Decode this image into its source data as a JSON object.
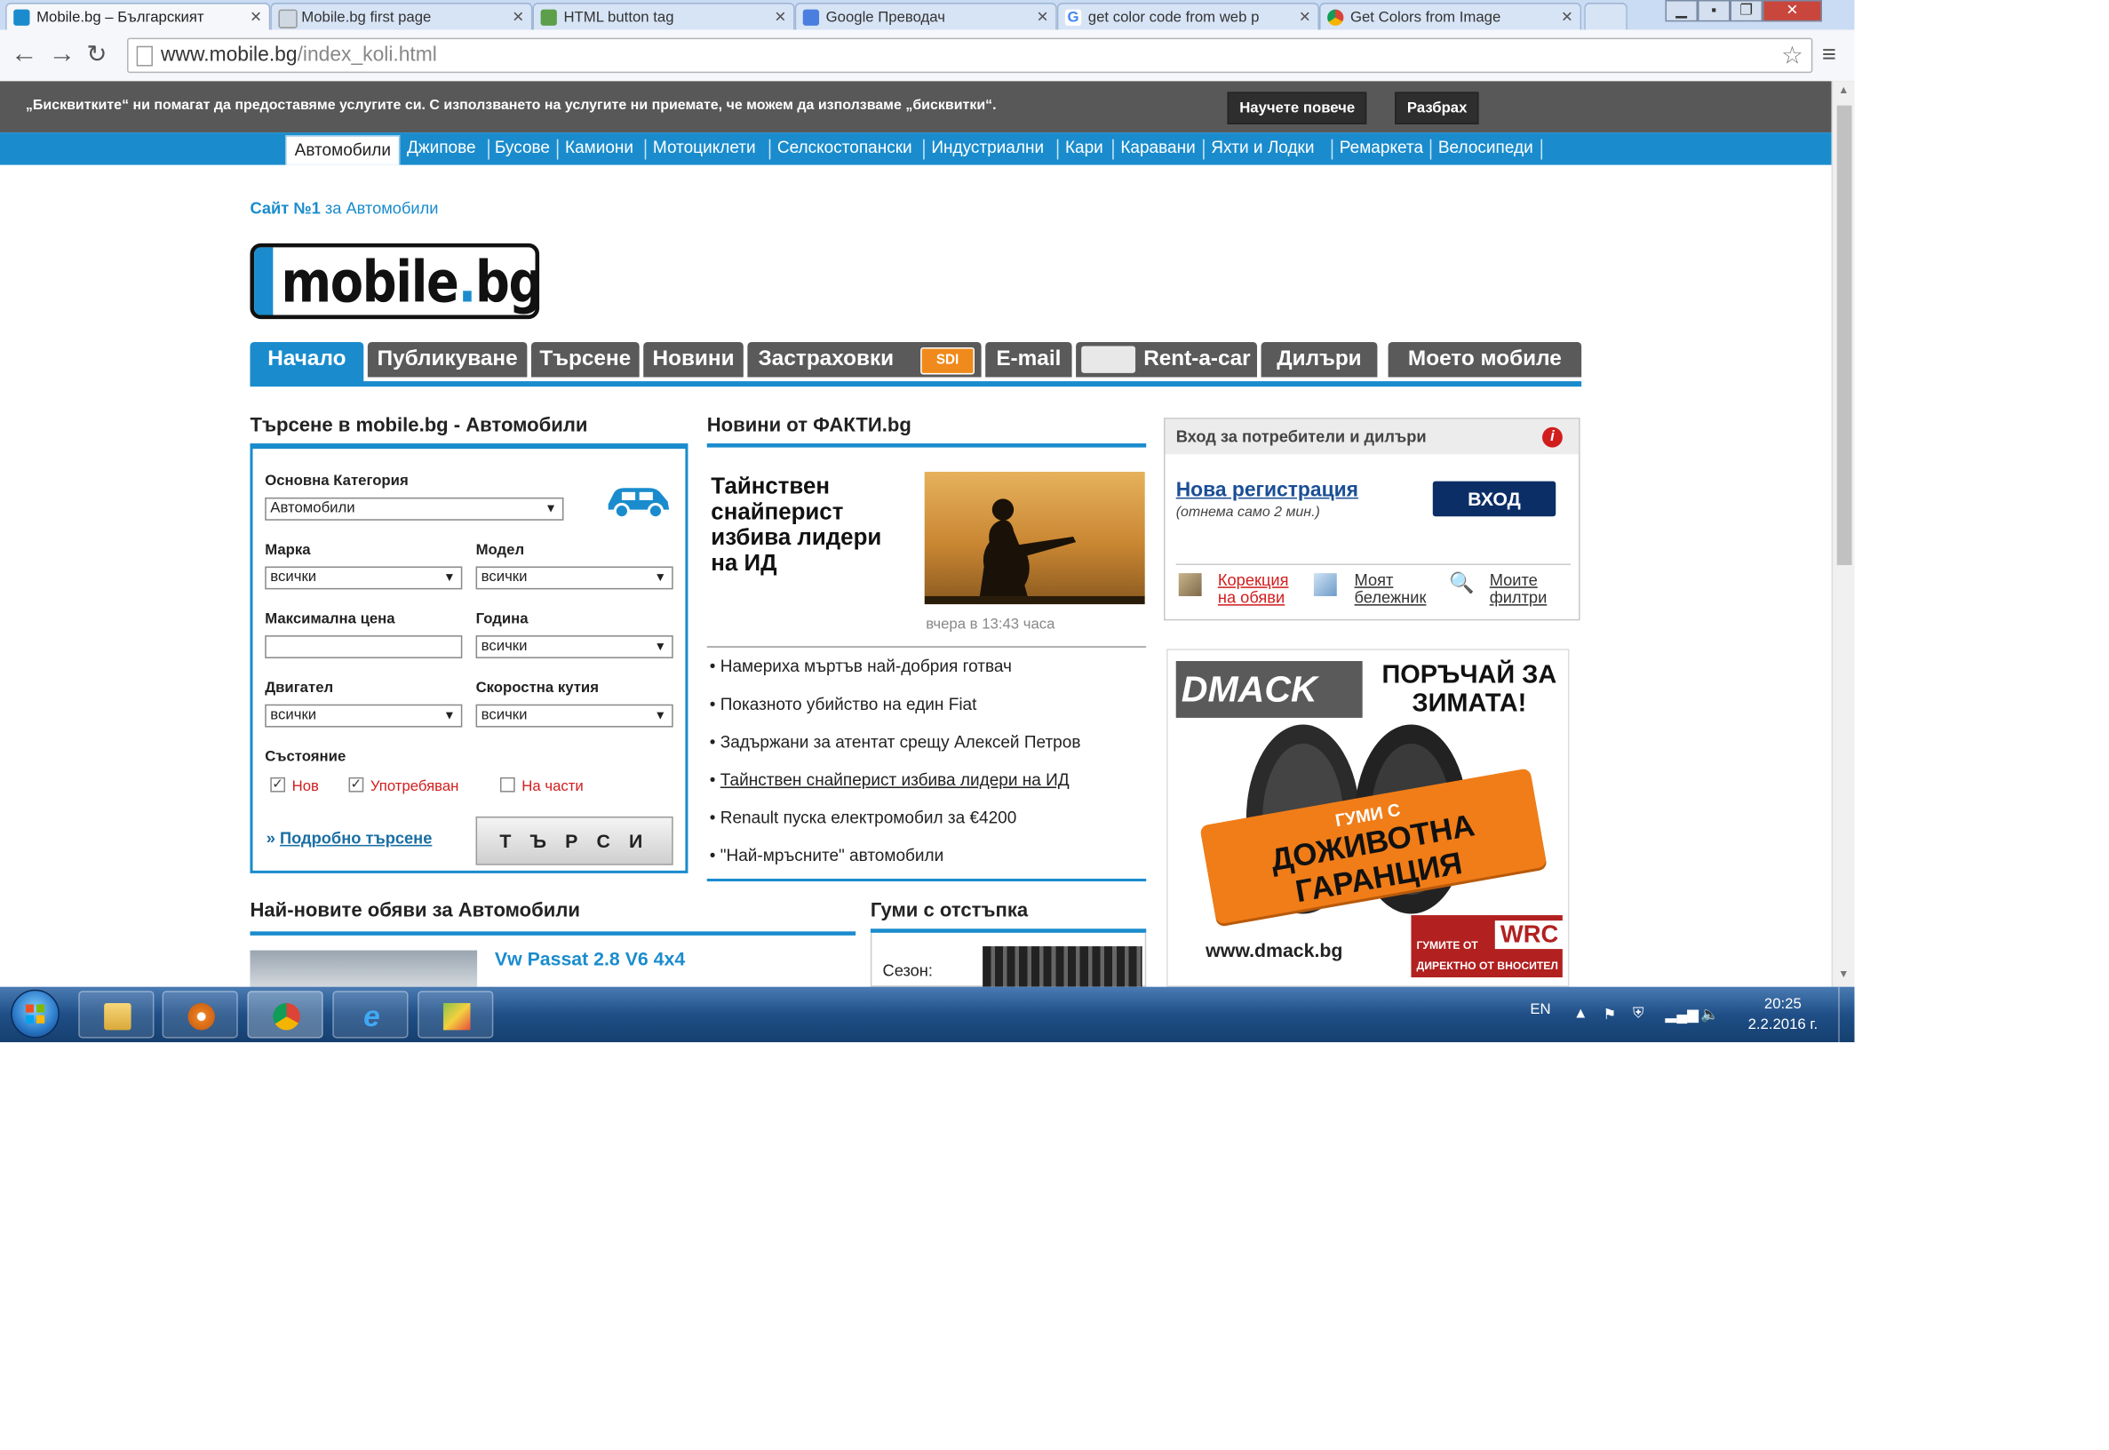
{
  "browser": {
    "tabs": [
      {
        "label": "Mobile.bg – Българският",
        "active": true
      },
      {
        "label": "Mobile.bg first page"
      },
      {
        "label": "HTML button tag"
      },
      {
        "label": "Google Преводач"
      },
      {
        "label": "get color code from web p"
      },
      {
        "label": "Get Colors from Image"
      }
    ],
    "url_host": "www.mobile.bg",
    "url_path": "/index_koli.html"
  },
  "cookie_bar": {
    "text": "„Бисквитките“ ни помагат да предоставяме услугите си. С използването на услугите ни приемате, че можем да използваме „бисквитки“.",
    "learn_more": "Научете повече",
    "accept": "Разбрах"
  },
  "category_bar": {
    "active": "Автомобили",
    "items": [
      "Джипове",
      "Бусове",
      "Камиони",
      "Мотоциклети",
      "Селскостопански",
      "Индустриални",
      "Кари",
      "Каравани",
      "Яхти и Лодки",
      "Ремаркета",
      "Велосипеди"
    ]
  },
  "tagline": {
    "strong": "Сайт №1",
    "rest": " за Автомобили"
  },
  "logo": {
    "text": "mobile",
    "dot": ".",
    "tld": "bg"
  },
  "main_nav": {
    "items": [
      "Начало",
      "Публикуване",
      "Търсене",
      "Новини",
      "Застраховки",
      "E-mail",
      "Rent-a-car",
      "Дилъри"
    ],
    "badge": "SDI",
    "my": "Моето мобиле"
  },
  "search": {
    "title": "Търсене в mobile.bg - Автомобили",
    "main_category_label": "Основна Категория",
    "main_category_value": "Автомобили",
    "brand_label": "Марка",
    "brand_value": "всички",
    "model_label": "Модел",
    "model_value": "всички",
    "max_price_label": "Максимална цена",
    "year_label": "Година",
    "year_value": "всички",
    "engine_label": "Двигател",
    "engine_value": "всички",
    "gearbox_label": "Скоростна кутия",
    "gearbox_value": "всички",
    "condition_label": "Състояние",
    "cond_new": "Нов",
    "cond_used": "Употребяван",
    "cond_parts": "На части",
    "advanced_prefix": "»",
    "advanced": "Подробно търсене",
    "button": "Т Ъ Р С И"
  },
  "news": {
    "title": "Новини от ФАКТИ.bg",
    "headline": "Тайнствен снайперист избива лидери на ИД",
    "date": "вчера в 13:43 часа",
    "items": [
      "Намериха мъртъв най-добрия готвач",
      "Показното убийство на един Fiat",
      "Задържани за атентат срещу Алексей Петров",
      "Тайнствен снайперист избива лидери на ИД",
      "Renault пуска електромобил за €4200",
      "\"Най-мръсните\" автомобили"
    ]
  },
  "login": {
    "title": "Вход за потребители и дилъри",
    "info": "i",
    "register": "Нова регистрация",
    "register_note": "(отнема само 2 мин.)",
    "login_button": "ВХОД",
    "link1_a": "Корекция",
    "link1_b": "на обяви",
    "link2_a": "Моят",
    "link2_b": "бележник",
    "link3_a": "Моите",
    "link3_b": "филтри"
  },
  "ad": {
    "brand": "DMACK",
    "headline1": "ПОРЪЧАЙ ЗА",
    "headline2": "ЗИМАТА!",
    "banner_small": "ГУМИ С",
    "banner_big": "ДОЖИВОТНА ГАРАНЦИЯ",
    "site": "www.dmack.bg",
    "tag1": "ГУМИТЕ ОТ",
    "wrc": "WRC",
    "tag2": "ДИРЕКТНО ОТ ВНОСИТЕЛ"
  },
  "latest": {
    "title": "Най-новите обяви за Автомобили",
    "first_listing": "Vw Passat 2.8 V6 4x4"
  },
  "tires": {
    "title": "Гуми с отстъпка",
    "season_label": "Сезон:"
  },
  "taskbar": {
    "lang": "EN",
    "time": "20:25",
    "date": "2.2.2016 г."
  }
}
